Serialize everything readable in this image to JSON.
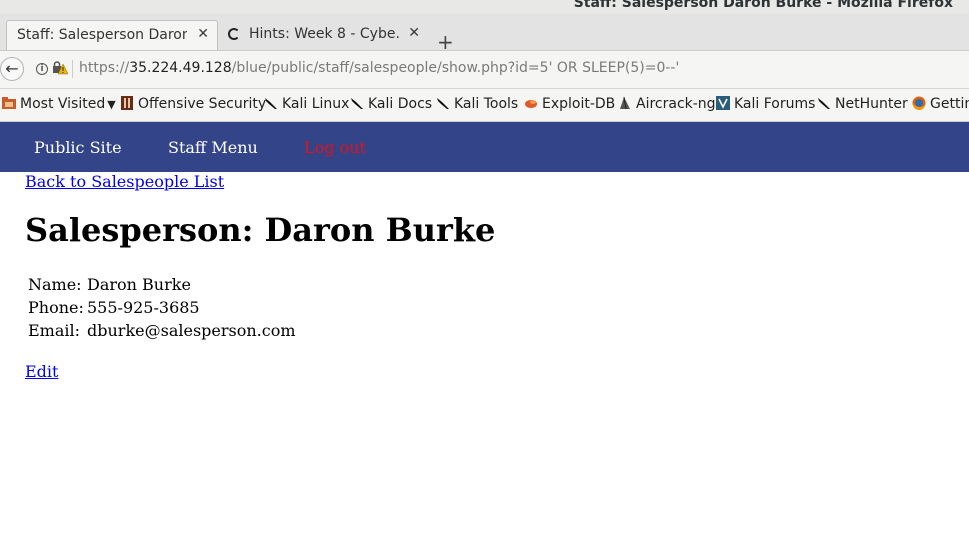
{
  "window": {
    "title": "Staff: Salesperson Daron Burke - Mozilla Firefox"
  },
  "tabs": [
    {
      "label": "Staff: Salesperson Daron...",
      "close": "✕",
      "active": true
    },
    {
      "label": "Hints: Week 8 - Cybe...",
      "close": "✕",
      "active": false
    }
  ],
  "newtab_label": "+",
  "nav": {
    "back_icon": "←",
    "url_prefix": "https://",
    "url_host": "35.224.49.128",
    "url_path": "/blue/public/staff/salespeople/show.php?id=5' OR SLEEP(5)=0--'"
  },
  "bookmarks": [
    {
      "label": "Most Visited",
      "icon": "folder-icon",
      "chevron": true
    },
    {
      "label": "Offensive Security",
      "icon": "offsec-icon"
    },
    {
      "label": "Kali Linux",
      "icon": "kali-dragon-icon"
    },
    {
      "label": "Kali Docs",
      "icon": "kali-dragon-icon"
    },
    {
      "label": "Kali Tools",
      "icon": "kali-dragon-icon"
    },
    {
      "label": "Exploit-DB",
      "icon": "exploitdb-icon"
    },
    {
      "label": "Aircrack-ng",
      "icon": "aircrack-icon"
    },
    {
      "label": "Kali Forums",
      "icon": "kali-forums-icon"
    },
    {
      "label": "NetHunter",
      "icon": "kali-dragon-icon"
    },
    {
      "label": "Gettin",
      "icon": "firefox-icon"
    }
  ],
  "page": {
    "nav_public": "Public Site",
    "nav_staff": "Staff Menu",
    "nav_logout": "Log out",
    "back_link": "Back to Salespeople List",
    "heading": "Salesperson: Daron Burke",
    "fields": [
      {
        "label": "Name:",
        "value": "Daron Burke"
      },
      {
        "label": "Phone:",
        "value": "555-925-3685"
      },
      {
        "label": "Email:",
        "value": "dburke@salesperson.com"
      }
    ],
    "edit_link": "Edit"
  },
  "colors": {
    "site_nav_bg": "#334488",
    "logout": "#e0131b",
    "link": "#0000ee"
  }
}
